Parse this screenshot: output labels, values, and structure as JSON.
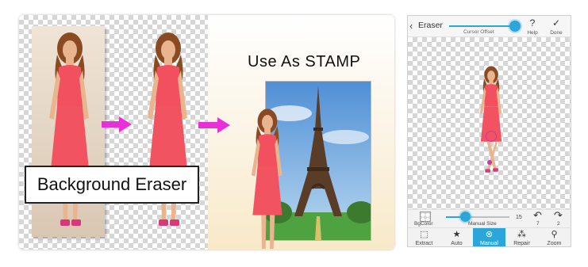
{
  "promo": {
    "label": "Background Eraser",
    "stamp_title": "Use As STAMP"
  },
  "app": {
    "back_icon": "chevron-left-icon",
    "title": "Eraser",
    "cursor_offset_label": "Cursor Offset",
    "help_label": "Help",
    "help_glyph": "?",
    "done_label": "Done",
    "done_glyph": "✓",
    "tools": {
      "bgcolor_label": "BgColor",
      "manual_size_label": "Manual Size",
      "manual_size_value": "15",
      "undo_count": "7",
      "redo_count": "2",
      "undo_glyph": "↶",
      "redo_glyph": "↷"
    },
    "nav": [
      {
        "label": "Extract",
        "icon": "extract-icon",
        "glyph": "⬚"
      },
      {
        "label": "Auto",
        "icon": "star-icon",
        "glyph": "★"
      },
      {
        "label": "Manual",
        "icon": "eraser-circle-icon",
        "glyph": "⊗"
      },
      {
        "label": "Repair",
        "icon": "repair-icon",
        "glyph": "⁂"
      },
      {
        "label": "Zoom",
        "icon": "zoom-icon",
        "glyph": "⚲"
      }
    ],
    "active_tab": "Manual"
  },
  "colors": {
    "accent": "#2aa6d9",
    "arrow": "#e830d8",
    "dress": "#f2505e"
  }
}
